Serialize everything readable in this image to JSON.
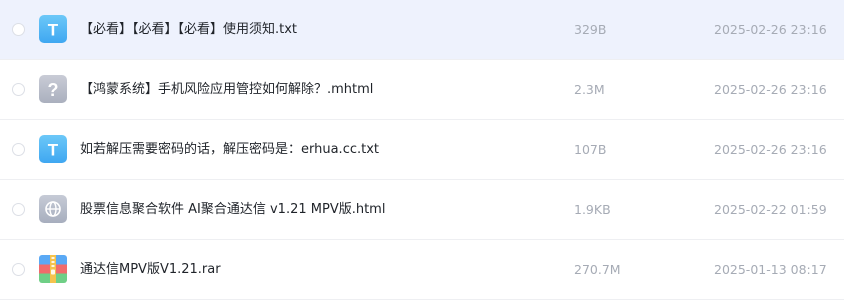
{
  "files": [
    {
      "name": "【必看】【必看】【必看】使用须知.txt",
      "size": "329B",
      "date": "2025-02-26 23:16",
      "icon": "txt-file-icon",
      "icon_glyph": "T",
      "selected": true
    },
    {
      "name": "【鸿蒙系统】手机风险应用管控如何解除？.mhtml",
      "size": "2.3M",
      "date": "2025-02-26 23:16",
      "icon": "unknown-file-icon",
      "icon_glyph": "?",
      "selected": false
    },
    {
      "name": "如若解压需要密码的话，解压密码是：erhua.cc.txt",
      "size": "107B",
      "date": "2025-02-26 23:16",
      "icon": "txt-file-icon",
      "icon_glyph": "T",
      "selected": false
    },
    {
      "name": "股票信息聚合软件 AI聚合通达信 v1.21 MPV版.html",
      "size": "1.9KB",
      "date": "2025-02-22 01:59",
      "icon": "html-file-icon",
      "icon_glyph": "",
      "selected": false
    },
    {
      "name": "通达信MPV版V1.21.rar",
      "size": "270.7M",
      "date": "2025-01-13 08:17",
      "icon": "rar-archive-icon",
      "icon_glyph": "",
      "selected": false
    }
  ],
  "colors": {
    "selected_row_bg": "#eef2fd",
    "txt_icon": "#4fb3f4",
    "generic_icon": "#b5bac6",
    "meta_text": "#a6abb5",
    "name_text": "#1f2329"
  }
}
